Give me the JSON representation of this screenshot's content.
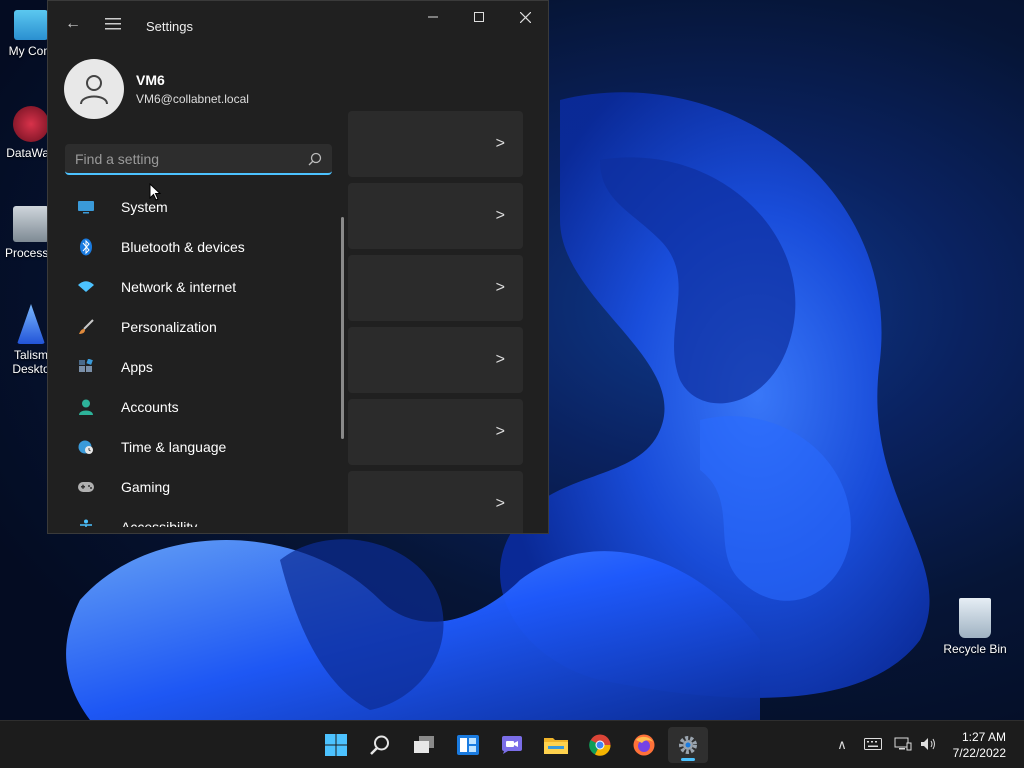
{
  "window": {
    "title": "Settings",
    "minimize": "—",
    "maximize": "☐",
    "close": "✕"
  },
  "profile": {
    "name": "VM6",
    "email": "VM6@collabnet.local"
  },
  "search": {
    "placeholder": "Find a setting"
  },
  "nav": {
    "items": [
      {
        "label": "System",
        "icon": "monitor-icon",
        "color": "#3a9ad9"
      },
      {
        "label": "Bluetooth & devices",
        "icon": "bluetooth-icon",
        "color": "#1a7be0"
      },
      {
        "label": "Network & internet",
        "icon": "wifi-icon",
        "color": "#4cc2ff"
      },
      {
        "label": "Personalization",
        "icon": "brush-icon",
        "color": "#e08a3c"
      },
      {
        "label": "Apps",
        "icon": "apps-icon",
        "color": "#7a8fa8"
      },
      {
        "label": "Accounts",
        "icon": "person-icon",
        "color": "#2db39a"
      },
      {
        "label": "Time & language",
        "icon": "globe-clock-icon",
        "color": "#3a9ad9"
      },
      {
        "label": "Gaming",
        "icon": "gamepad-icon",
        "color": "#b0b0b0"
      },
      {
        "label": "Accessibility",
        "icon": "accessibility-icon",
        "color": "#4cc2ff"
      }
    ]
  },
  "content": {
    "cards": [
      ">",
      ">",
      ">",
      ">",
      ">",
      ">"
    ]
  },
  "desktop": {
    "icons": [
      {
        "label": "My Com",
        "icon": "computer-icon"
      },
      {
        "label": "DataWag",
        "icon": "datawag-icon"
      },
      {
        "label": "ProcessH",
        "icon": "process-icon"
      },
      {
        "label": "Talism Deskto",
        "icon": "talisman-icon"
      },
      {
        "label": "Recycle Bin",
        "icon": "recycle-bin-icon"
      }
    ]
  },
  "taskbar": {
    "apps": [
      "start-icon",
      "search-icon",
      "task-view-icon",
      "widgets-icon",
      "chat-icon",
      "file-explorer-icon",
      "chrome-icon",
      "firefox-icon",
      "settings-icon"
    ]
  },
  "clock": {
    "time": "1:27 AM",
    "date": "7/22/2022"
  },
  "colors": {
    "accent": "#4cc2ff",
    "window_bg": "#202020",
    "card_bg": "#2b2b2b"
  }
}
